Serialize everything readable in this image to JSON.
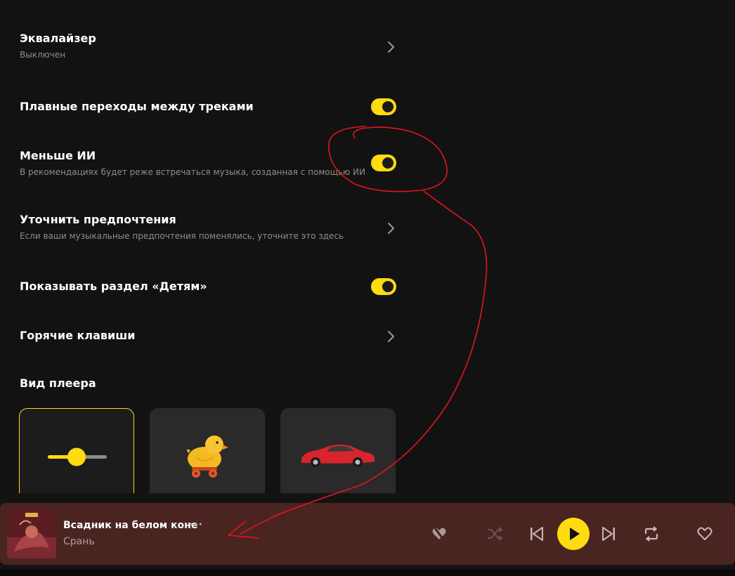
{
  "settings": {
    "equalizer": {
      "title": "Эквалайзер",
      "subtitle": "Выключен"
    },
    "crossfade": {
      "title": "Плавные переходы между треками",
      "enabled": true
    },
    "less_ai": {
      "title": "Меньше ИИ",
      "subtitle": "В рекомендациях будет реже встречаться музыка, созданная с помощью ИИ",
      "enabled": true
    },
    "preferences": {
      "title": "Уточнить предпочтения",
      "subtitle": "Если ваши музыкальные предпочтения поменялись, уточните это здесь"
    },
    "kids": {
      "title": "Показывать раздел «Детям»",
      "enabled": true
    },
    "hotkeys": {
      "title": "Горячие клавиши"
    },
    "player_view": {
      "title": "Вид плеера",
      "options": [
        {
          "icon": "slider-icon",
          "selected": true
        },
        {
          "icon": "duck-toy-icon",
          "selected": false
        },
        {
          "icon": "sports-car-icon",
          "selected": false
        }
      ]
    }
  },
  "player": {
    "track_title": "Всадник на белом коне",
    "artist": "Срань",
    "more_label": "···",
    "controls": [
      "dislike-icon",
      "shuffle-icon",
      "previous-icon",
      "play-icon",
      "next-icon",
      "repeat-icon",
      "like-icon"
    ]
  },
  "colors": {
    "accent": "#ffdb0f",
    "background": "#121212",
    "player_background": "#4a2420",
    "annotation": "#e3141e"
  }
}
